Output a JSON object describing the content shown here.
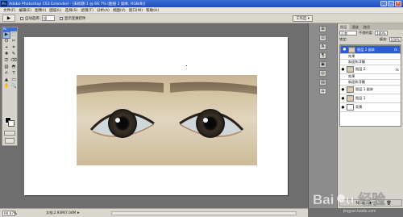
{
  "titlebar": {
    "app_icon": "Ps",
    "title": "Adobe Photoshop CS3 Extended - [未标题-1 @ 66.7% (图层 2 副本, RGB/8)]",
    "buttons": [
      "_",
      "□",
      "×"
    ]
  },
  "menu": [
    "文件(F)",
    "编辑(E)",
    "图像(I)",
    "图层(L)",
    "选择(S)",
    "滤镜(T)",
    "分析(A)",
    "视图(V)",
    "窗口(W)",
    "帮助(H)"
  ],
  "options": {
    "auto_select_label": "自动选择:",
    "auto_select_value": "组",
    "show_transform_label": "显示变换控件",
    "workspace_label": "工作区 ▾"
  },
  "toolbox": {
    "header": "Ps",
    "tools": [
      "▶",
      "⬚",
      "ʘ",
      "✂",
      "⌖",
      "⌗",
      "✚",
      "✎",
      "⎚",
      "⌫",
      "▥",
      "◓",
      "✍",
      "T",
      "▲",
      "▭",
      "✋",
      "🔍"
    ]
  },
  "status": {
    "zoom": "66.67%",
    "doc": "文档:2.93M/7.04M",
    "arrow": "▸"
  },
  "dock": {
    "icons": [
      "⊞",
      "⊡",
      "A",
      "¶",
      "▣",
      "◎",
      "▤",
      "⌂"
    ]
  },
  "panel": {
    "tabs": [
      "图层",
      "通道",
      "路径"
    ],
    "blend_mode": "正常",
    "opacity_label": "不透明度:",
    "opacity_value": "100%",
    "lock_label": "锁定:",
    "fill_label": "填充:",
    "fill_value": "100%",
    "layers": [
      {
        "name": "图层 2 副本",
        "selected": true,
        "fx": "fx"
      },
      {
        "name": "效果",
        "sub": true
      },
      {
        "name": "斜面和浮雕",
        "sub": true
      },
      {
        "name": "图层 2",
        "fx": "fx"
      },
      {
        "name": "效果",
        "sub": true
      },
      {
        "name": "斜面和浮雕",
        "sub": true
      },
      {
        "name": "图层 1 副本"
      },
      {
        "name": "图层 1"
      },
      {
        "name": "背景"
      }
    ],
    "bottom_icons": [
      "∞",
      "fx",
      "◐",
      "◑",
      "▭",
      "▢",
      "🗑"
    ]
  },
  "watermark": {
    "text": "Baidu 经验",
    "url": "jingyan.baidu.com"
  }
}
